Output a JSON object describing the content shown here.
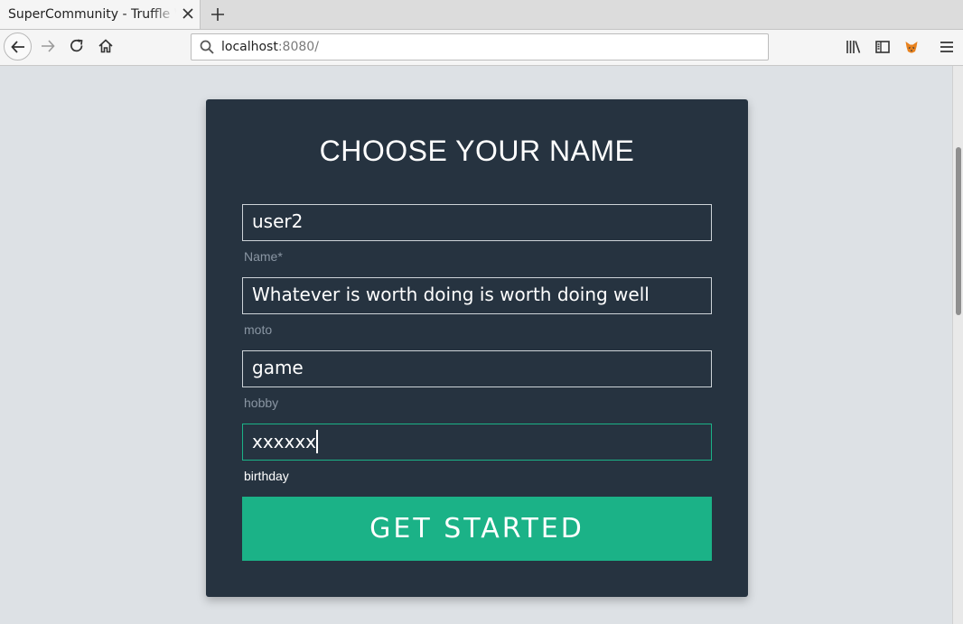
{
  "browser": {
    "tab": {
      "title": "SuperCommunity - Truffle Webpack"
    },
    "url": {
      "host": "localhost",
      "port": ":8080/"
    },
    "icons": {
      "close": "close-icon",
      "new_tab": "plus-icon",
      "back": "back-arrow-icon",
      "forward": "forward-arrow-icon",
      "reload": "reload-icon",
      "home": "home-icon",
      "search": "search-icon",
      "library": "library-icon",
      "sidebar": "sidebar-icon",
      "extension": "metamask-fox-icon",
      "menu": "hamburger-menu-icon"
    }
  },
  "form": {
    "title": "CHOOSE YOUR NAME",
    "fields": [
      {
        "value": "user2",
        "label": "Name*"
      },
      {
        "value": "Whatever is worth doing is worth doing well",
        "label": "moto"
      },
      {
        "value": "game",
        "label": "hobby"
      },
      {
        "value": "xxxxxx",
        "label": "birthday"
      }
    ],
    "submit_label": "GET STARTED"
  },
  "colors": {
    "page_background": "#dde1e5",
    "card_background": "#263340",
    "accent": "#1bb287",
    "label_muted": "#8a96a3",
    "text": "#ffffff"
  }
}
